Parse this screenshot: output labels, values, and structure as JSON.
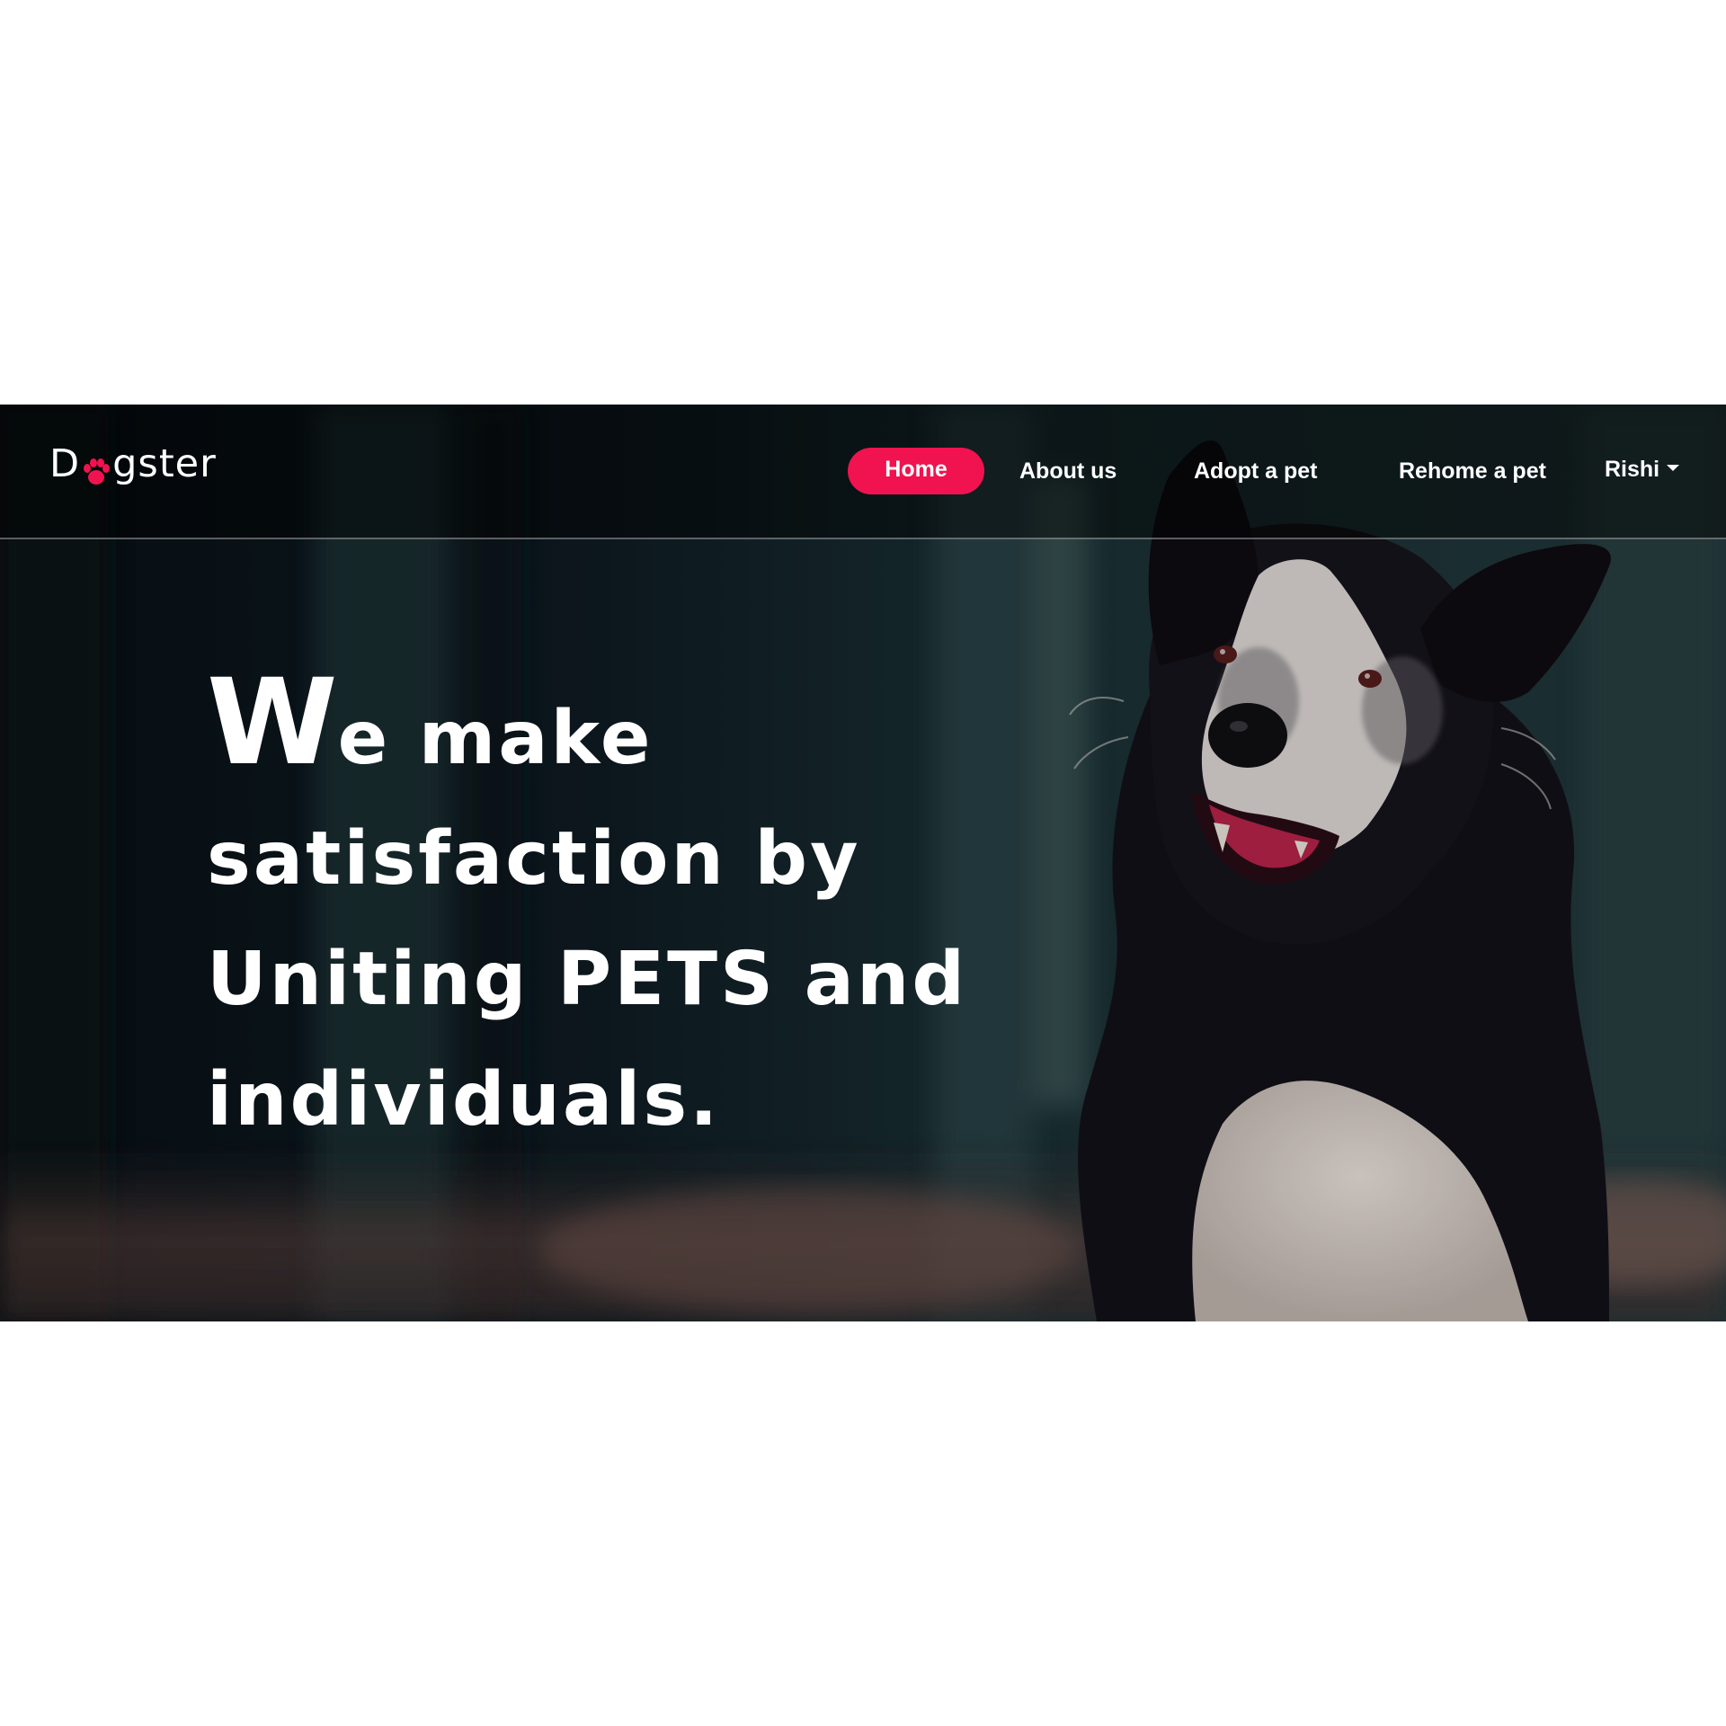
{
  "brand": {
    "name_prefix": "D",
    "name_suffix": "gster",
    "accent_color": "#f0134f"
  },
  "nav": {
    "items": [
      {
        "label": "Home",
        "active": true
      },
      {
        "label": "About us",
        "active": false
      },
      {
        "label": "Adopt a pet",
        "active": false
      },
      {
        "label": "Rehome a pet",
        "active": false
      }
    ],
    "user": {
      "name": "Rishi",
      "icon": "caret-down-icon"
    }
  },
  "hero": {
    "headline_first_letter": "W",
    "headline_line1_rest": "e make",
    "headline_line2": "satisfaction by",
    "headline_line3": "Uniting PETS and",
    "headline_line4": "individuals.",
    "image": "border-collie-photo"
  }
}
